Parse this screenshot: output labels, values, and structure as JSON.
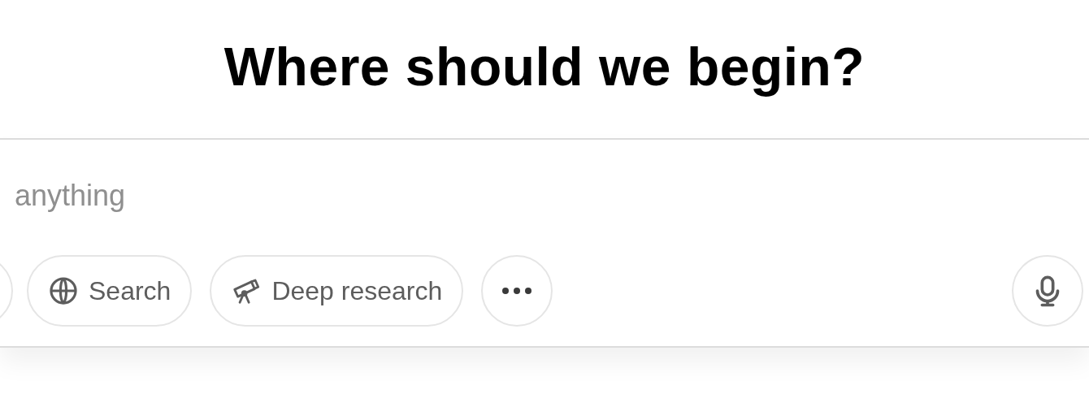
{
  "heading": "Where should we begin?",
  "composer": {
    "placeholder": "anything",
    "tools": [
      {
        "kind": "round"
      },
      {
        "kind": "search",
        "label": "Search"
      },
      {
        "kind": "research",
        "label": "Deep research"
      },
      {
        "kind": "more"
      }
    ],
    "voice": {
      "kind": "mic"
    }
  }
}
